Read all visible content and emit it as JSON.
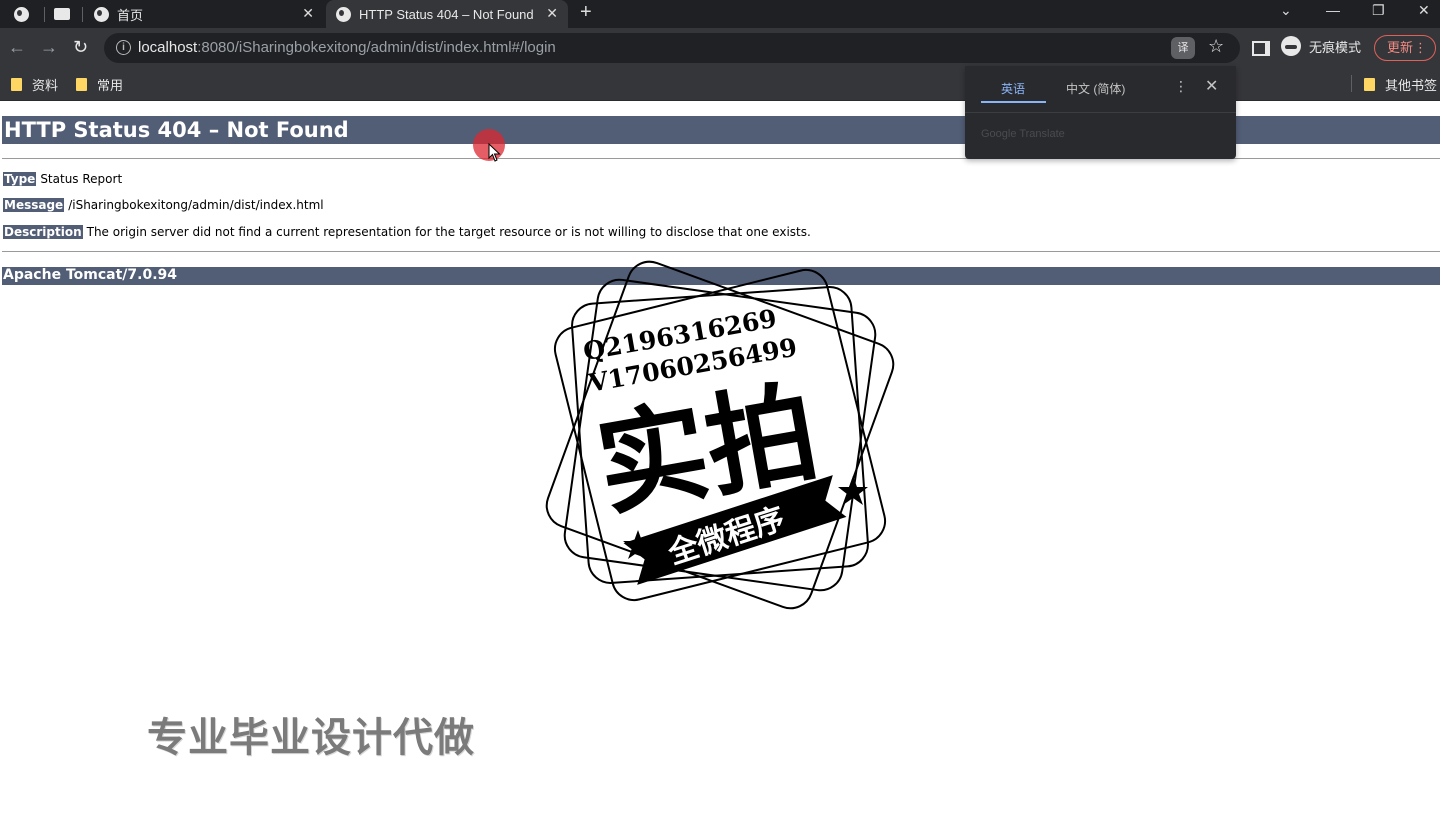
{
  "browser": {
    "tabs": [
      {
        "title": "首页"
      },
      {
        "title": "HTTP Status 404 – Not Found"
      }
    ],
    "close_glyph": "✕",
    "new_tab_glyph": "+",
    "window_controls": {
      "dropdown": "⌄",
      "minimize": "—",
      "restore": "❐",
      "close": "✕"
    },
    "nav": {
      "back": "←",
      "forward": "→",
      "reload": "↻"
    },
    "url": {
      "host": "localhost",
      "rest": ":8080/iSharingbokexitong/admin/dist/index.html#/login"
    },
    "star_glyph": "☆",
    "translate_glyph": "译",
    "incognito_label": "无痕模式",
    "update_label": "更新",
    "menu_glyph": "⋮",
    "bookmarks": [
      {
        "label": "资料"
      },
      {
        "label": "常用"
      }
    ],
    "other_bookmarks": "其他书签"
  },
  "translate_popup": {
    "source_lang": "英语",
    "target_lang": "中文 (简体)",
    "menu_glyph": "⋮",
    "close_glyph": "✕",
    "footer": "Google Translate"
  },
  "page": {
    "heading": "HTTP Status 404 – Not Found",
    "rows": [
      {
        "key": "Type",
        "value": "Status Report"
      },
      {
        "key": "Message",
        "value": "/iSharingbokexitong/admin/dist/index.html"
      },
      {
        "key": "Description",
        "value": "The origin server did not find a current representation for the target resource or is not willing to disclose that one exists."
      }
    ],
    "footer": "Apache Tomcat/7.0.94"
  },
  "watermark": {
    "line1": "Q2196316269",
    "line2": "V17060256499",
    "big": "实拍",
    "banner": "全微程序",
    "caption": "专业毕业设计代做"
  },
  "colors": {
    "heading_bar": "#525d76",
    "chrome_dark": "#1f2024",
    "toolbar": "#35363a",
    "accent_blue": "#8ab4f8"
  }
}
